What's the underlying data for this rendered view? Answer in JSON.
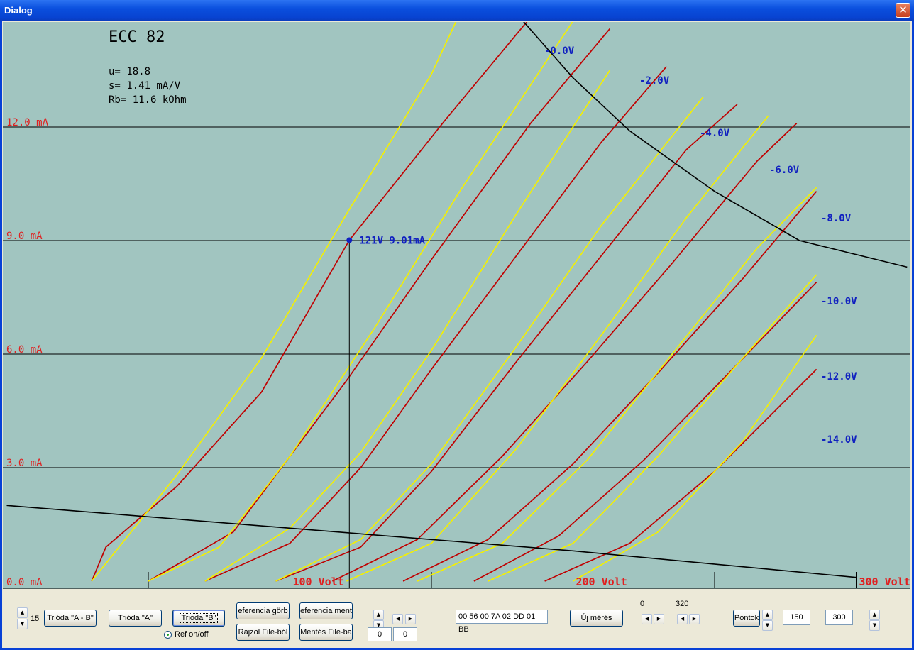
{
  "window": {
    "title": "Dialog",
    "close_glyph": "✕"
  },
  "colors": {
    "plot_bg": "#A1C5C0",
    "red_curve": "#C00000",
    "yellow_curve": "#F4F000",
    "grid": "#000000",
    "y_label": "#E02020",
    "bias_label": "#1020C0",
    "x_label": "#E02020"
  },
  "plot": {
    "tube_name": "ECC 82",
    "params": [
      "u= 18.8",
      "s= 1.41 mA/V",
      "Rb= 11.6 kOhm"
    ],
    "cursor_label": "121V 9.01mA",
    "y_labels": [
      "12.0 mA",
      "9.0 mA",
      "6.0 mA",
      "3.0 mA",
      "0.0 mA"
    ],
    "x_labels": [
      "100 Volt",
      "200 Volt",
      "300 Volt"
    ],
    "bias_labels": [
      "-0.0V",
      "-2.0V",
      "-4.0V",
      "-6.0V",
      "-8.0V",
      "-10.0V",
      "-12.0V",
      "-14.0V"
    ]
  },
  "chart_data": {
    "type": "line",
    "title": "ECC 82",
    "xlabel": "",
    "ylabel": "",
    "xlim": [
      0,
      318
    ],
    "ylim": [
      0,
      15
    ],
    "x_ticks": [
      100,
      200,
      300
    ],
    "y_ticks": [
      0,
      3,
      6,
      9,
      12
    ],
    "grid": true,
    "series": [
      {
        "name": "-0.0V",
        "color": "#C00000",
        "points": [
          [
            30,
            0
          ],
          [
            35,
            0.9
          ],
          [
            60,
            2.5
          ],
          [
            90,
            5
          ],
          [
            121,
            9.01
          ],
          [
            155,
            12.2
          ],
          [
            185,
            14.9
          ]
        ]
      },
      {
        "name": "-0.0V",
        "color": "#F4F000",
        "points": [
          [
            30,
            0
          ],
          [
            60,
            2.8
          ],
          [
            90,
            5.9
          ],
          [
            120,
            9.7
          ],
          [
            150,
            13.4
          ],
          [
            160,
            15
          ]
        ]
      },
      {
        "name": "-2.0V",
        "color": "#C00000",
        "points": [
          [
            50,
            0
          ],
          [
            80,
            1.3
          ],
          [
            100,
            3.3
          ],
          [
            120,
            5.3
          ],
          [
            150,
            8.5
          ],
          [
            185,
            12.1
          ],
          [
            213,
            14.6
          ]
        ]
      },
      {
        "name": "-2.0V",
        "color": "#F4F000",
        "points": [
          [
            50,
            0
          ],
          [
            75,
            0.9
          ],
          [
            100,
            3.3
          ],
          [
            130,
            6.7
          ],
          [
            160,
            10.3
          ],
          [
            200,
            14.8
          ]
        ]
      },
      {
        "name": "-4.0V",
        "color": "#C00000",
        "points": [
          [
            70,
            0
          ],
          [
            100,
            1
          ],
          [
            125,
            3
          ],
          [
            150,
            5.6
          ],
          [
            180,
            8.6
          ],
          [
            210,
            11.6
          ],
          [
            233,
            13.6
          ]
        ]
      },
      {
        "name": "-4.0V",
        "color": "#F4F000",
        "points": [
          [
            70,
            0
          ],
          [
            100,
            1.4
          ],
          [
            125,
            3.4
          ],
          [
            150,
            6.1
          ],
          [
            180,
            9.7
          ],
          [
            213,
            13.5
          ]
        ]
      },
      {
        "name": "-6.0V",
        "color": "#C00000",
        "points": [
          [
            95,
            0
          ],
          [
            125,
            0.9
          ],
          [
            150,
            2.9
          ],
          [
            180,
            5.8
          ],
          [
            210,
            8.6
          ],
          [
            240,
            11.4
          ],
          [
            258,
            12.6
          ]
        ]
      },
      {
        "name": "-6.0V",
        "color": "#F4F000",
        "points": [
          [
            95,
            0
          ],
          [
            125,
            1.1
          ],
          [
            150,
            3.1
          ],
          [
            180,
            6.2
          ],
          [
            210,
            9.4
          ],
          [
            246,
            12.8
          ]
        ]
      },
      {
        "name": "-8.0V",
        "color": "#C00000",
        "points": [
          [
            115,
            0
          ],
          [
            145,
            1.1
          ],
          [
            175,
            3.3
          ],
          [
            205,
            5.8
          ],
          [
            235,
            8.4
          ],
          [
            265,
            11.1
          ],
          [
            279,
            12.1
          ]
        ]
      },
      {
        "name": "-8.0V",
        "color": "#F4F000",
        "points": [
          [
            120,
            0
          ],
          [
            150,
            1
          ],
          [
            180,
            3.5
          ],
          [
            210,
            6.5
          ],
          [
            240,
            9.6
          ],
          [
            269,
            12.3
          ]
        ]
      },
      {
        "name": "-10.0V",
        "color": "#C00000",
        "points": [
          [
            140,
            0
          ],
          [
            170,
            1.1
          ],
          [
            200,
            3.1
          ],
          [
            230,
            5.5
          ],
          [
            260,
            8
          ],
          [
            286,
            10.3
          ]
        ]
      },
      {
        "name": "-10.0V",
        "color": "#F4F000",
        "points": [
          [
            145,
            0
          ],
          [
            175,
            1
          ],
          [
            205,
            3.2
          ],
          [
            235,
            6
          ],
          [
            265,
            8.8
          ],
          [
            286,
            10.4
          ]
        ]
      },
      {
        "name": "-12.0V",
        "color": "#C00000",
        "points": [
          [
            165,
            0
          ],
          [
            195,
            1.2
          ],
          [
            225,
            3.2
          ],
          [
            255,
            5.5
          ],
          [
            286,
            7.9
          ]
        ]
      },
      {
        "name": "-12.0V",
        "color": "#F4F000",
        "points": [
          [
            170,
            0
          ],
          [
            200,
            1
          ],
          [
            230,
            3.3
          ],
          [
            260,
            5.9
          ],
          [
            286,
            8.1
          ]
        ]
      },
      {
        "name": "-14.0V",
        "color": "#C00000",
        "points": [
          [
            190,
            0
          ],
          [
            220,
            1
          ],
          [
            250,
            2.9
          ],
          [
            286,
            5.6
          ]
        ]
      },
      {
        "name": "-14.0V",
        "color": "#F4F000",
        "points": [
          [
            200,
            0
          ],
          [
            230,
            1.3
          ],
          [
            260,
            3.7
          ],
          [
            286,
            6.5
          ]
        ]
      },
      {
        "name": "",
        "color": "#000000",
        "points": [
          [
            180,
            15
          ],
          [
            200,
            13.3
          ],
          [
            220,
            11.9
          ],
          [
            250,
            10.3
          ],
          [
            280,
            9
          ],
          [
            318,
            8.3
          ]
        ]
      },
      {
        "name": "",
        "color": "#000000",
        "points": [
          [
            0,
            2
          ],
          [
            100,
            1.4
          ],
          [
            200,
            0.8
          ],
          [
            300,
            0.1
          ]
        ]
      }
    ],
    "cursor": {
      "x": 121,
      "y": 9.01
    }
  },
  "controls": {
    "left_spin_value": "15",
    "buttons": {
      "trioda_ab": "Trióda \"A - B\"",
      "trioda_a": "Trióda  \"A\"",
      "trioda_b": "Trióda  \"B\"",
      "ref_gorbe": "eferencia görb",
      "ref_mentes": "eferencia ment",
      "rajzol_file": "Rajzol File-ból",
      "mentes_file": "Mentés File-ba",
      "uj_meres": "Új mérés",
      "pontok": "Pontok"
    },
    "ref_onoff": "Ref on/off",
    "small_field_1": "0",
    "small_field_2": "0",
    "hex_field": "00 56 00 7A 02 DD 01 BB",
    "label_0": "0",
    "label_320": "320",
    "field_150": "150",
    "field_300": "300"
  }
}
